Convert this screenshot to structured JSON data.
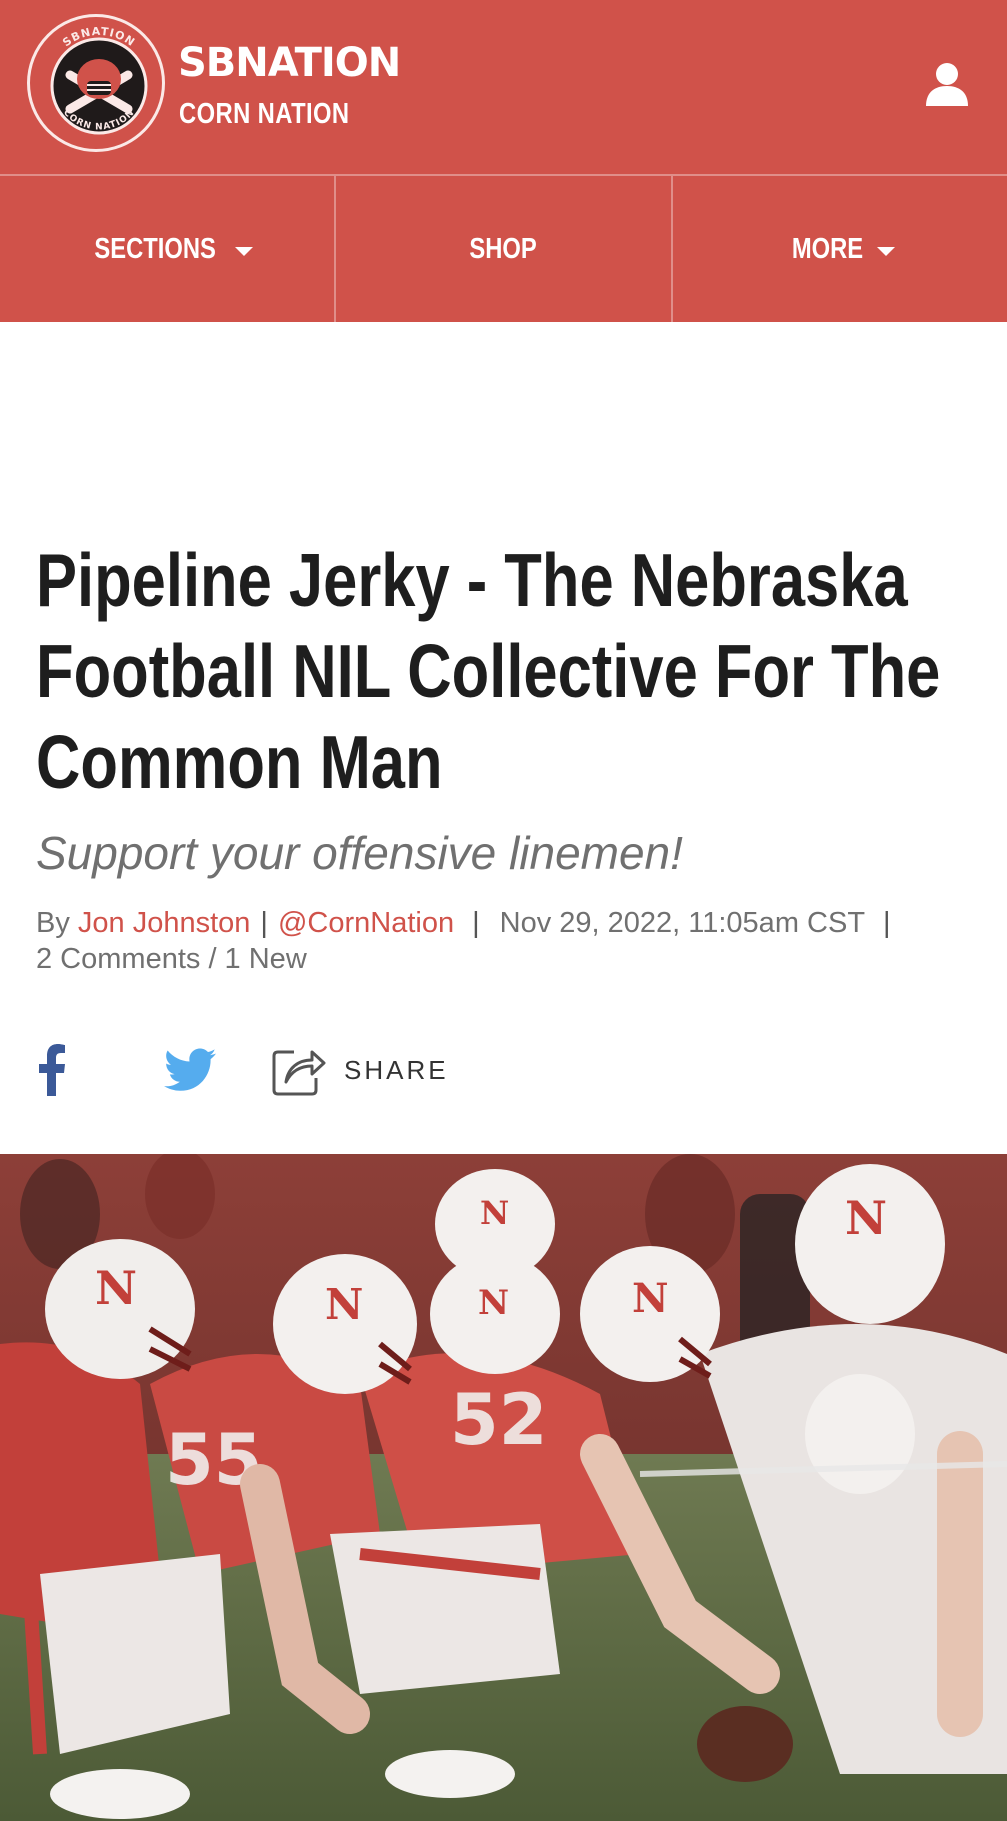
{
  "header": {
    "brand": "SBNATION",
    "site_name": "CORN NATION",
    "logo_ring_top": "SBNATION",
    "logo_ring_bottom": "CORN NATION"
  },
  "nav": {
    "items": [
      {
        "label": "SECTIONS",
        "has_caret": true
      },
      {
        "label": "SHOP",
        "has_caret": false
      },
      {
        "label": "MORE",
        "has_caret": true
      }
    ]
  },
  "article": {
    "headline_lines": [
      "Pipeline Jerky - The Nebraska",
      "Football NIL Collective For The",
      "Common Man"
    ],
    "dek": "Support your offensive linemen!",
    "byline": {
      "by": "By",
      "author": "Jon Johnston",
      "handle": "@CornNation",
      "date": "Nov 29, 2022, 11:05am CST",
      "comments": "2 Comments / 1 New"
    },
    "share": {
      "label": "SHARE",
      "icons": [
        "facebook-icon",
        "twitter-icon",
        "share-icon"
      ]
    }
  },
  "colors": {
    "brand_red": "#d0524a",
    "headline": "#1e1e1e",
    "meta_gray": "#707070",
    "facebook_blue": "#3b5998",
    "twitter_blue": "#55acee"
  }
}
